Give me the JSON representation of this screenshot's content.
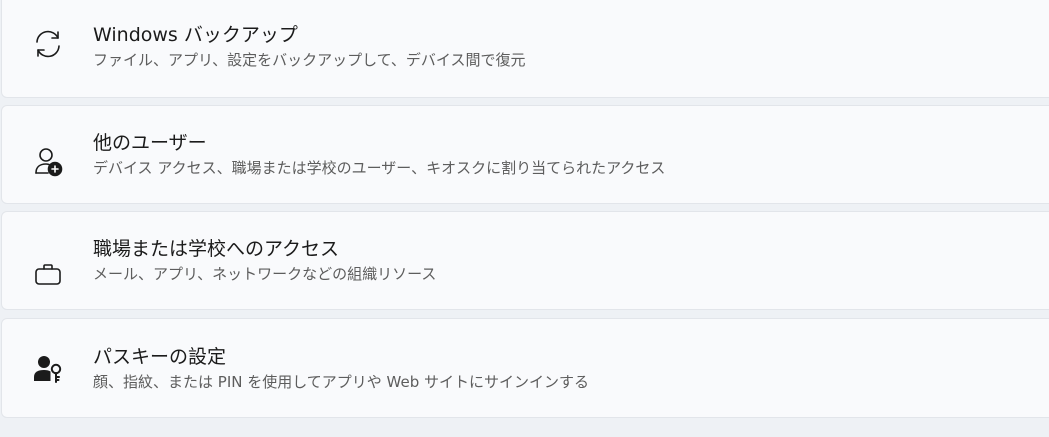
{
  "settings": {
    "items": [
      {
        "icon": "sync-icon",
        "title": "Windows バックアップ",
        "description": "ファイル、アプリ、設定をバックアップして、デバイス間で復元"
      },
      {
        "icon": "add-user-icon",
        "title": "他のユーザー",
        "description": "デバイス アクセス、職場または学校のユーザー、キオスクに割り当てられたアクセス"
      },
      {
        "icon": "briefcase-icon",
        "title": "職場または学校へのアクセス",
        "description": "メール、アプリ、ネットワークなどの組織リソース"
      },
      {
        "icon": "passkey-icon",
        "title": "パスキーの設定",
        "description": "顔、指紋、または PIN を使用してアプリや Web サイトにサインインする"
      }
    ]
  },
  "colors": {
    "background": "#eef1f5",
    "card": "#f9fafc",
    "card_border": "#e2e5ea",
    "title_text": "#1b1b1b",
    "description_text": "#5d5d5d",
    "icon": "#1b1b1b"
  }
}
